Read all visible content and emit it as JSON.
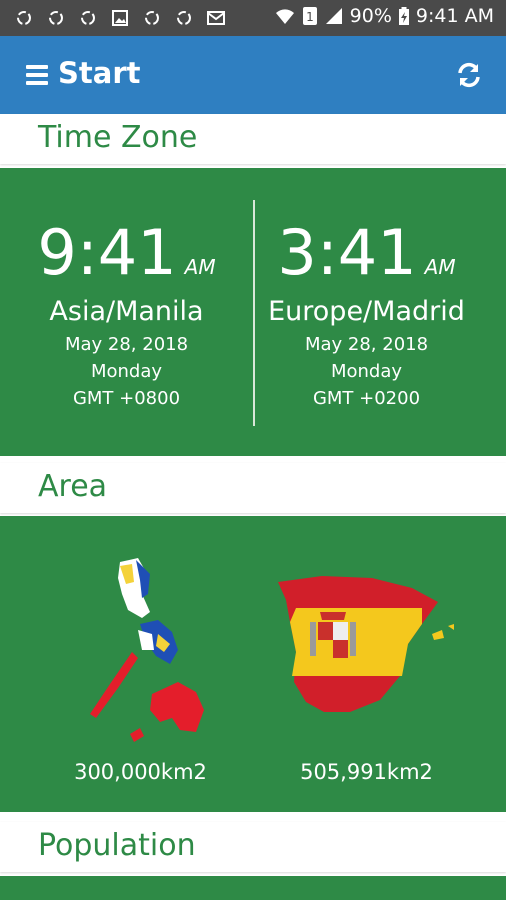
{
  "status_bar": {
    "battery": "90%",
    "time": "9:41 AM",
    "sim_badge": "1",
    "left_icons": [
      "sync-icon",
      "sync-icon",
      "sync-icon",
      "image-icon",
      "sync-icon",
      "sync-icon",
      "mail-icon"
    ]
  },
  "app_bar": {
    "title": "Start",
    "color": "#2f7fc1"
  },
  "sections": {
    "time_zone": "Time Zone",
    "area": "Area",
    "population": "Population"
  },
  "time_zone": {
    "left": {
      "time": "9:41",
      "ampm": "AM",
      "zone": "Asia/Manila",
      "date": "May 28, 2018",
      "day": "Monday",
      "gmt": "GMT +0800"
    },
    "right": {
      "time": "3:41",
      "ampm": "AM",
      "zone": "Europe/Madrid",
      "date": "May 28, 2018",
      "day": "Monday",
      "gmt": "GMT +0200"
    }
  },
  "area": {
    "left_value": "300,000km2",
    "right_value": "505,991km2"
  },
  "colors": {
    "panel_green": "#2e8a46",
    "header_text": "#2e8a46"
  }
}
